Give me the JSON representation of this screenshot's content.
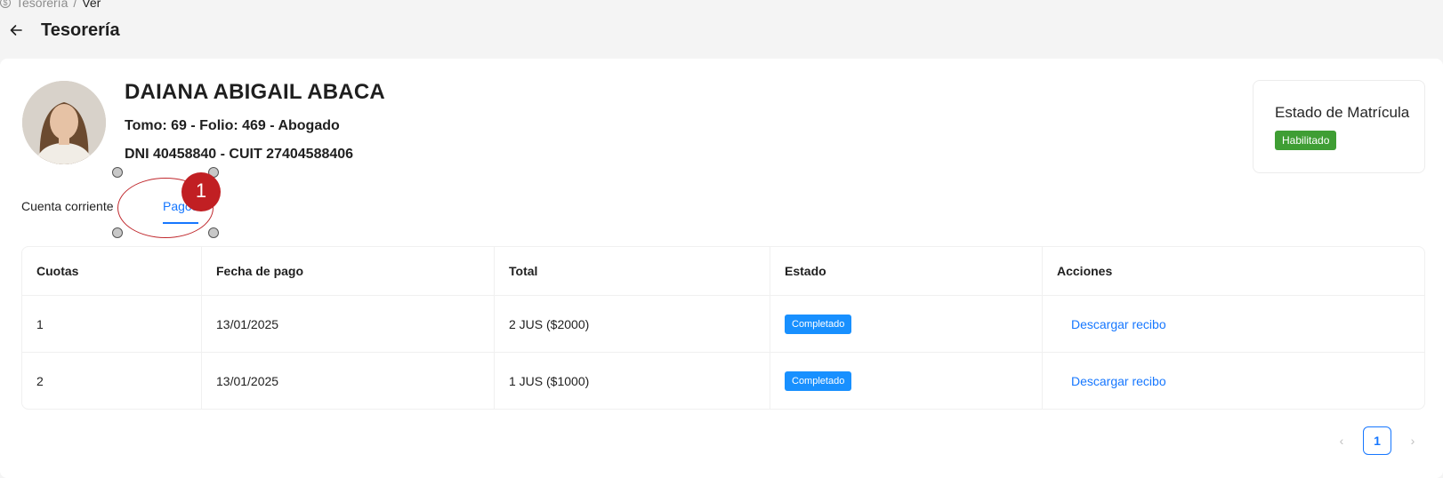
{
  "breadcrumb": {
    "root": "Tesorería",
    "separator": "/",
    "current": "Ver"
  },
  "header": {
    "title": "Tesorería"
  },
  "profile": {
    "name": "DAIANA ABIGAIL ABACA",
    "registration": "Tomo: 69 - Folio: 469 - Abogado",
    "ids": "DNI 40458840 - CUIT 27404588406"
  },
  "status": {
    "title": "Estado de Matrícula",
    "tag": "Habilitado",
    "tag_color": "#3f9e34"
  },
  "tabs": [
    {
      "label": "Cuenta corriente",
      "active": false
    },
    {
      "label": "Pagos",
      "active": true
    }
  ],
  "annotation": {
    "number": "1",
    "color": "#c11f23"
  },
  "table": {
    "columns": [
      "Cuotas",
      "Fecha de pago",
      "Total",
      "Estado",
      "Acciones"
    ],
    "rows": [
      {
        "cuota": "1",
        "fecha": "13/01/2025",
        "total": "2 JUS ($2000)",
        "estado": "Completado",
        "accion": "Descargar recibo"
      },
      {
        "cuota": "2",
        "fecha": "13/01/2025",
        "total": "1 JUS ($1000)",
        "estado": "Completado",
        "accion": "Descargar recibo"
      }
    ]
  },
  "pagination": {
    "current": "1",
    "prev_icon": "‹",
    "next_icon": "›"
  },
  "colors": {
    "accent": "#1677ff",
    "badge_blue": "#1890ff"
  }
}
